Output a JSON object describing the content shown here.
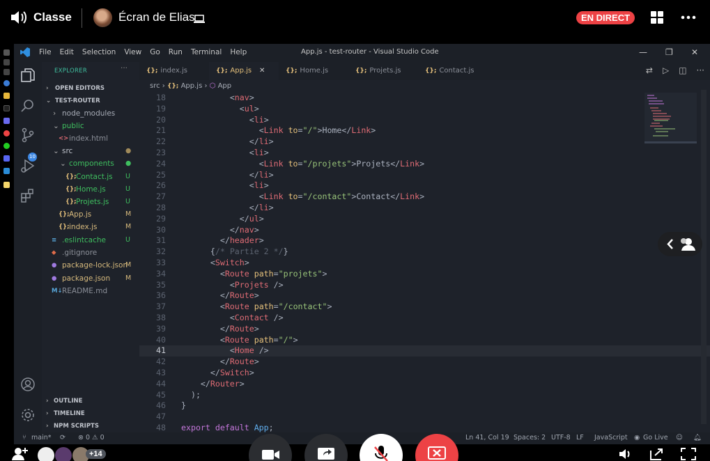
{
  "stream": {
    "channel": "Classe",
    "title": "Écran de Elias",
    "live": "EN DIRECT",
    "participants_extra": "+14"
  },
  "colors": {
    "accent": "#ed4245",
    "keyword": "#e06c75",
    "string": "#98c379",
    "attr": "#e5c07b",
    "text": "#abb2bf",
    "comment": "#5c6370"
  },
  "vscode": {
    "menu": [
      "File",
      "Edit",
      "Selection",
      "View",
      "Go",
      "Run",
      "Terminal",
      "Help"
    ],
    "window_title": "App.js - test-router - Visual Studio Code",
    "explorer_label": "EXPLORER",
    "explorer_more": "···",
    "scm_badge": "10",
    "tabs": [
      {
        "label": "index.js",
        "icon": "{};"
      },
      {
        "label": "App.js",
        "icon": "{};"
      },
      {
        "label": "Home.js",
        "icon": "{};"
      },
      {
        "label": "Projets.js",
        "icon": "{};"
      },
      {
        "label": "Contact.js",
        "icon": "{};"
      }
    ],
    "breadcrumb": {
      "folder": "src",
      "file": "App.js",
      "symbol": "App"
    },
    "tree": [
      {
        "label": "OPEN EDITORS",
        "arrow": "›",
        "indent": 0,
        "section": true,
        "status": ""
      },
      {
        "label": "TEST-ROUTER",
        "arrow": "⌄",
        "indent": 0,
        "section": true,
        "status": ""
      },
      {
        "label": "node_modules",
        "arrow": "›",
        "indent": 1,
        "section": false,
        "status": "",
        "color": "#a8adb7"
      },
      {
        "label": "public",
        "arrow": "⌄",
        "indent": 1,
        "section": false,
        "status": "",
        "color": "#3fbf5f"
      },
      {
        "label": "index.html",
        "arrow": "",
        "indent": 2,
        "section": false,
        "status": "",
        "color": "#8b8f98",
        "icon": "<>"
      },
      {
        "label": "src",
        "arrow": "⌄",
        "indent": 1,
        "section": false,
        "status": "●",
        "color": "#c0c4cc"
      },
      {
        "label": "components",
        "arrow": "⌄",
        "indent": 2,
        "section": false,
        "status": "●",
        "color": "#3fbf5f"
      },
      {
        "label": "Contact.js",
        "arrow": "",
        "indent": 3,
        "section": false,
        "status": "U",
        "color": "#3fbf5f",
        "icon": "{};"
      },
      {
        "label": "Home.js",
        "arrow": "",
        "indent": 3,
        "section": false,
        "status": "U",
        "color": "#3fbf5f",
        "icon": "{};"
      },
      {
        "label": "Projets.js",
        "arrow": "",
        "indent": 3,
        "section": false,
        "status": "U",
        "color": "#3fbf5f",
        "icon": "{};"
      },
      {
        "label": "App.js",
        "arrow": "",
        "indent": 2,
        "section": false,
        "status": "M",
        "color": "#d7ba7d",
        "icon": "{};"
      },
      {
        "label": "index.js",
        "arrow": "",
        "indent": 2,
        "section": false,
        "status": "M",
        "color": "#d7ba7d",
        "icon": "{};"
      },
      {
        "label": ".eslintcache",
        "arrow": "",
        "indent": 1,
        "section": false,
        "status": "U",
        "color": "#3fbf5f",
        "icon": "≡"
      },
      {
        "label": ".gitignore",
        "arrow": "",
        "indent": 1,
        "section": false,
        "status": "",
        "color": "#8b8f98",
        "icon": "◆"
      },
      {
        "label": "package-lock.json",
        "arrow": "",
        "indent": 1,
        "section": false,
        "status": "M",
        "color": "#d7ba7d",
        "icon": "●"
      },
      {
        "label": "package.json",
        "arrow": "",
        "indent": 1,
        "section": false,
        "status": "M",
        "color": "#d7ba7d",
        "icon": "●"
      },
      {
        "label": "README.md",
        "arrow": "",
        "indent": 1,
        "section": false,
        "status": "",
        "color": "#8b8f98",
        "icon": "M↓"
      }
    ],
    "bottom_sections": [
      "OUTLINE",
      "TIMELINE",
      "NPM SCRIPTS"
    ],
    "code": [
      {
        "n": "18",
        "t": [
          [
            "",
            "          "
          ],
          [
            "p",
            "<"
          ],
          [
            "k",
            "nav"
          ],
          [
            "p",
            ">"
          ]
        ]
      },
      {
        "n": "19",
        "t": [
          [
            "",
            "            "
          ],
          [
            "p",
            "<"
          ],
          [
            "k",
            "ul"
          ],
          [
            "p",
            ">"
          ]
        ]
      },
      {
        "n": "20",
        "t": [
          [
            "",
            "              "
          ],
          [
            "p",
            "<"
          ],
          [
            "k",
            "li"
          ],
          [
            "p",
            ">"
          ]
        ]
      },
      {
        "n": "21",
        "t": [
          [
            "",
            "                "
          ],
          [
            "p",
            "<"
          ],
          [
            "k",
            "Link"
          ],
          [
            "",
            ""
          ],
          [
            "a",
            " to"
          ],
          [
            "p",
            "="
          ],
          [
            "s",
            "\"/\""
          ],
          [
            "p",
            ">"
          ],
          [
            "",
            "Home"
          ],
          [
            "p",
            "</"
          ],
          [
            "k",
            "Link"
          ],
          [
            "p",
            ">"
          ]
        ]
      },
      {
        "n": "22",
        "t": [
          [
            "",
            "              "
          ],
          [
            "p",
            "</"
          ],
          [
            "k",
            "li"
          ],
          [
            "p",
            ">"
          ]
        ]
      },
      {
        "n": "23",
        "t": [
          [
            "",
            "              "
          ],
          [
            "p",
            "<"
          ],
          [
            "k",
            "li"
          ],
          [
            "p",
            ">"
          ]
        ]
      },
      {
        "n": "24",
        "t": [
          [
            "",
            "                "
          ],
          [
            "p",
            "<"
          ],
          [
            "k",
            "Link"
          ],
          [
            "a",
            " to"
          ],
          [
            "p",
            "="
          ],
          [
            "s",
            "\"/projets\""
          ],
          [
            "p",
            ">"
          ],
          [
            "",
            "Projets"
          ],
          [
            "p",
            "</"
          ],
          [
            "k",
            "Link"
          ],
          [
            "p",
            ">"
          ]
        ]
      },
      {
        "n": "25",
        "t": [
          [
            "",
            "              "
          ],
          [
            "p",
            "</"
          ],
          [
            "k",
            "li"
          ],
          [
            "p",
            ">"
          ]
        ]
      },
      {
        "n": "26",
        "t": [
          [
            "",
            "              "
          ],
          [
            "p",
            "<"
          ],
          [
            "k",
            "li"
          ],
          [
            "p",
            ">"
          ]
        ]
      },
      {
        "n": "27",
        "t": [
          [
            "",
            "                "
          ],
          [
            "p",
            "<"
          ],
          [
            "k",
            "Link"
          ],
          [
            "a",
            " to"
          ],
          [
            "p",
            "="
          ],
          [
            "s",
            "\"/contact\""
          ],
          [
            "p",
            ">"
          ],
          [
            "",
            "Contact"
          ],
          [
            "p",
            "</"
          ],
          [
            "k",
            "Link"
          ],
          [
            "p",
            ">"
          ]
        ]
      },
      {
        "n": "28",
        "t": [
          [
            "",
            "              "
          ],
          [
            "p",
            "</"
          ],
          [
            "k",
            "li"
          ],
          [
            "p",
            ">"
          ]
        ]
      },
      {
        "n": "29",
        "t": [
          [
            "",
            "            "
          ],
          [
            "p",
            "</"
          ],
          [
            "k",
            "ul"
          ],
          [
            "p",
            ">"
          ]
        ]
      },
      {
        "n": "30",
        "t": [
          [
            "",
            "          "
          ],
          [
            "p",
            "</"
          ],
          [
            "k",
            "nav"
          ],
          [
            "p",
            ">"
          ]
        ]
      },
      {
        "n": "31",
        "t": [
          [
            "",
            "        "
          ],
          [
            "p",
            "</"
          ],
          [
            "k",
            "header"
          ],
          [
            "p",
            ">"
          ]
        ]
      },
      {
        "n": "32",
        "t": [
          [
            "",
            "      "
          ],
          [
            "p",
            "{"
          ],
          [
            "c",
            "/* Partie 2 */"
          ],
          [
            "p",
            "}"
          ]
        ]
      },
      {
        "n": "33",
        "t": [
          [
            "",
            "      "
          ],
          [
            "p",
            "<"
          ],
          [
            "k",
            "Switch"
          ],
          [
            "p",
            ">"
          ]
        ]
      },
      {
        "n": "34",
        "t": [
          [
            "",
            "        "
          ],
          [
            "p",
            "<"
          ],
          [
            "k",
            "Route"
          ],
          [
            "a",
            " path"
          ],
          [
            "p",
            "="
          ],
          [
            "s",
            "\"projets\""
          ],
          [
            "p",
            ">"
          ]
        ]
      },
      {
        "n": "35",
        "t": [
          [
            "",
            "          "
          ],
          [
            "p",
            "<"
          ],
          [
            "k",
            "Projets"
          ],
          [
            "p",
            " />"
          ]
        ]
      },
      {
        "n": "36",
        "t": [
          [
            "",
            "        "
          ],
          [
            "p",
            "</"
          ],
          [
            "k",
            "Route"
          ],
          [
            "p",
            ">"
          ]
        ]
      },
      {
        "n": "37",
        "t": [
          [
            "",
            "        "
          ],
          [
            "p",
            "<"
          ],
          [
            "k",
            "Route"
          ],
          [
            "a",
            " path"
          ],
          [
            "p",
            "="
          ],
          [
            "s",
            "\"/contact\""
          ],
          [
            "p",
            ">"
          ]
        ]
      },
      {
        "n": "38",
        "t": [
          [
            "",
            "          "
          ],
          [
            "p",
            "<"
          ],
          [
            "k",
            "Contact"
          ],
          [
            "p",
            " />"
          ]
        ]
      },
      {
        "n": "39",
        "t": [
          [
            "",
            "        "
          ],
          [
            "p",
            "</"
          ],
          [
            "k",
            "Route"
          ],
          [
            "p",
            ">"
          ]
        ]
      },
      {
        "n": "40",
        "t": [
          [
            "",
            "        "
          ],
          [
            "p",
            "<"
          ],
          [
            "k",
            "Route"
          ],
          [
            "a",
            " path"
          ],
          [
            "p",
            "="
          ],
          [
            "s",
            "\"/\""
          ],
          [
            "p",
            ">"
          ]
        ]
      },
      {
        "n": "41",
        "t": [
          [
            "",
            "          "
          ],
          [
            "p",
            "<"
          ],
          [
            "k",
            "Home"
          ],
          [
            "p",
            " />"
          ]
        ],
        "current": true
      },
      {
        "n": "42",
        "t": [
          [
            "",
            "        "
          ],
          [
            "p",
            "</"
          ],
          [
            "k",
            "Route"
          ],
          [
            "p",
            ">"
          ]
        ]
      },
      {
        "n": "43",
        "t": [
          [
            "",
            "      "
          ],
          [
            "p",
            "</"
          ],
          [
            "k",
            "Switch"
          ],
          [
            "p",
            ">"
          ]
        ]
      },
      {
        "n": "44",
        "t": [
          [
            "",
            "    "
          ],
          [
            "p",
            "</"
          ],
          [
            "k",
            "Router"
          ],
          [
            "p",
            ">"
          ]
        ]
      },
      {
        "n": "45",
        "t": [
          [
            "",
            "  "
          ],
          [
            "p",
            ");"
          ]
        ]
      },
      {
        "n": "46",
        "t": [
          [
            "p",
            "}"
          ]
        ]
      },
      {
        "n": "47",
        "t": [
          [
            "",
            ""
          ]
        ]
      },
      {
        "n": "48",
        "t": [
          [
            "kw",
            "export default "
          ],
          [
            "fn",
            "App"
          ],
          [
            "p",
            ";"
          ]
        ]
      }
    ],
    "status": {
      "branch": "main*",
      "problems": "⊗ 0 ⚠ 0",
      "position": "Ln 41, Col 19",
      "spaces": "Spaces: 2",
      "encoding": "UTF-8",
      "eol": "LF",
      "language": "JavaScript",
      "golive": "Go Live"
    }
  }
}
